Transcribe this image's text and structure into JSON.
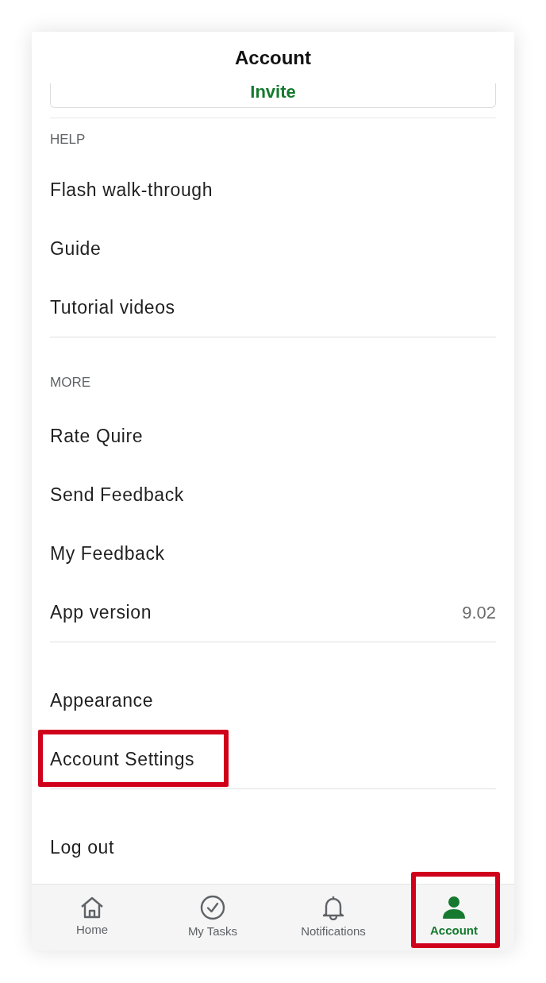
{
  "header": {
    "title": "Account"
  },
  "invite_button": {
    "label": "Invite"
  },
  "sections": [
    {
      "heading": "HELP",
      "items": [
        {
          "label": "Flash walk-through",
          "highlighted": false
        },
        {
          "label": "Guide",
          "highlighted": false
        },
        {
          "label": "Tutorial videos",
          "highlighted": false
        }
      ]
    },
    {
      "heading": "MORE",
      "items": [
        {
          "label": "Rate Quire",
          "highlighted": false
        },
        {
          "label": "Send Feedback",
          "highlighted": false
        },
        {
          "label": "My Feedback",
          "highlighted": false
        },
        {
          "label": "App version",
          "value": "9.02",
          "highlighted": false
        }
      ]
    },
    {
      "items": [
        {
          "label": "Appearance",
          "highlighted": false
        },
        {
          "label": "Account Settings",
          "highlighted": true
        }
      ]
    },
    {
      "items": [
        {
          "label": "Log out",
          "highlighted": false
        }
      ]
    }
  ],
  "nav": [
    {
      "label": "Home",
      "kind": "home",
      "selected": false,
      "highlighted": false
    },
    {
      "label": "My Tasks",
      "kind": "tasks",
      "selected": false,
      "highlighted": false
    },
    {
      "label": "Notifications",
      "kind": "bell",
      "selected": false,
      "highlighted": false
    },
    {
      "label": "Account",
      "kind": "person",
      "selected": true,
      "highlighted": true
    }
  ]
}
